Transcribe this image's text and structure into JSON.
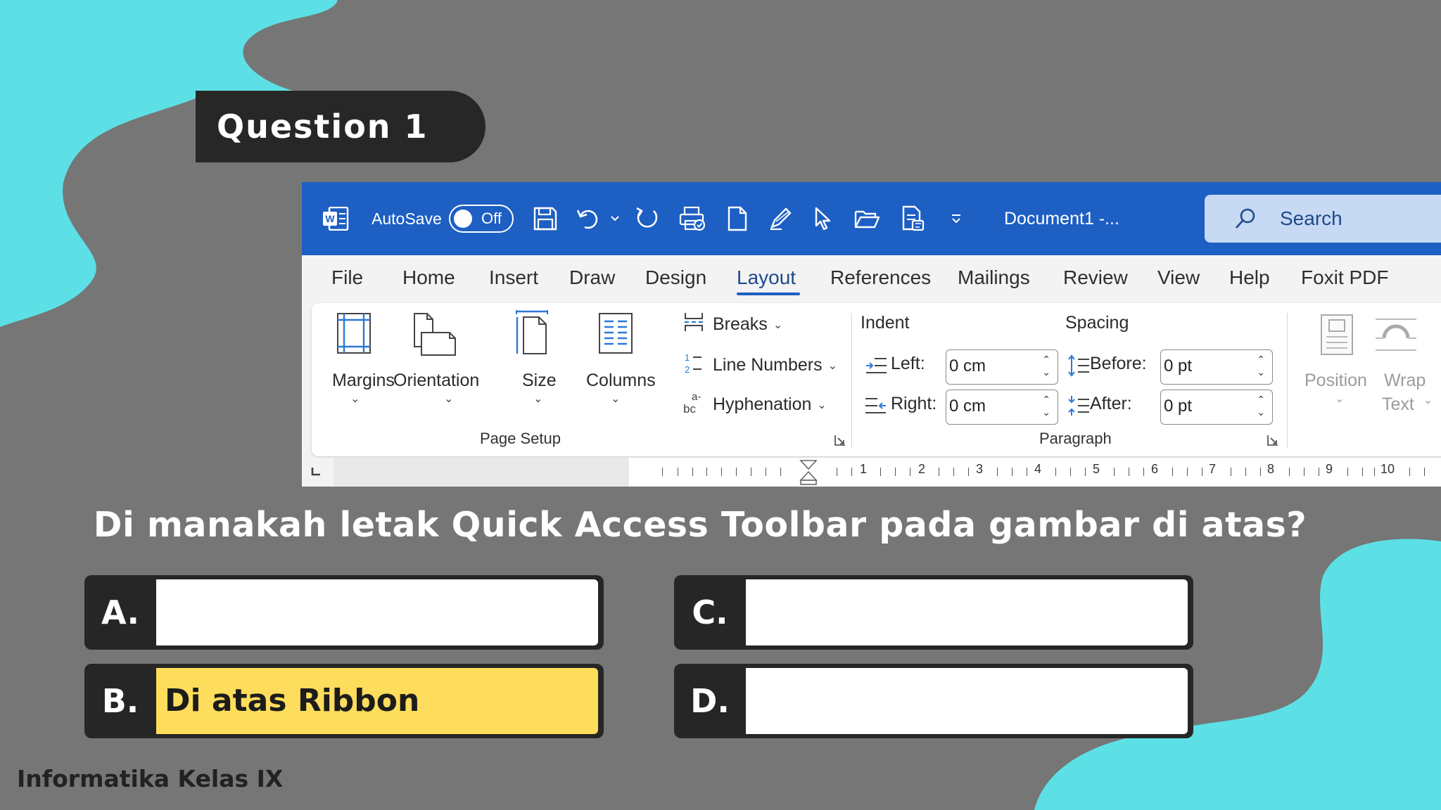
{
  "slide": {
    "title_tag": "Question 1",
    "question": "Di manakah letak Quick Access Toolbar pada gambar di atas?",
    "footer": "Informatika Kelas IX",
    "options": [
      {
        "letter": "A.",
        "text": "",
        "highlighted": false
      },
      {
        "letter": "B.",
        "text": "Di atas Ribbon",
        "highlighted": true
      },
      {
        "letter": "C.",
        "text": "",
        "highlighted": false
      },
      {
        "letter": "D.",
        "text": "",
        "highlighted": false
      }
    ],
    "colors": {
      "background": "#767676",
      "accent_shape": "#5ce0e6",
      "highlight": "#ffdd5c",
      "word_blue": "#1d5fc3"
    }
  },
  "word": {
    "titlebar": {
      "autosave_label": "AutoSave",
      "autosave_state": "Off",
      "doc_title": "Document1  -...",
      "search_placeholder": "Search",
      "qat_icons": [
        "save-icon",
        "undo-icon",
        "undo-dropdown-icon",
        "redo-icon",
        "print-preview-icon",
        "new-document-icon",
        "draw-pen-icon",
        "select-pointer-icon",
        "open-folder-icon",
        "document-export-icon",
        "customize-qat-icon"
      ]
    },
    "tabs": [
      "File",
      "Home",
      "Insert",
      "Draw",
      "Design",
      "Layout",
      "References",
      "Mailings",
      "Review",
      "View",
      "Help",
      "Foxit PDF"
    ],
    "active_tab": "Layout",
    "page_setup": {
      "group_label": "Page Setup",
      "margins": "Margins",
      "orientation": "Orientation",
      "size": "Size",
      "columns": "Columns",
      "breaks": "Breaks",
      "line_numbers": "Line Numbers",
      "hyphenation": "Hyphenation"
    },
    "paragraph": {
      "group_label": "Paragraph",
      "indent_header": "Indent",
      "spacing_header": "Spacing",
      "left_label": "Left:",
      "left_value": "0 cm",
      "right_label": "Right:",
      "right_value": "0 cm",
      "before_label": "Before:",
      "before_value": "0 pt",
      "after_label": "After:",
      "after_value": "0 pt"
    },
    "arrange": {
      "position": "Position",
      "wrap_line1": "Wrap",
      "wrap_line2": "Text"
    },
    "ruler": {
      "numbers": [
        "1",
        "2",
        "3",
        "4",
        "5",
        "6",
        "7",
        "8",
        "9",
        "10"
      ]
    }
  }
}
